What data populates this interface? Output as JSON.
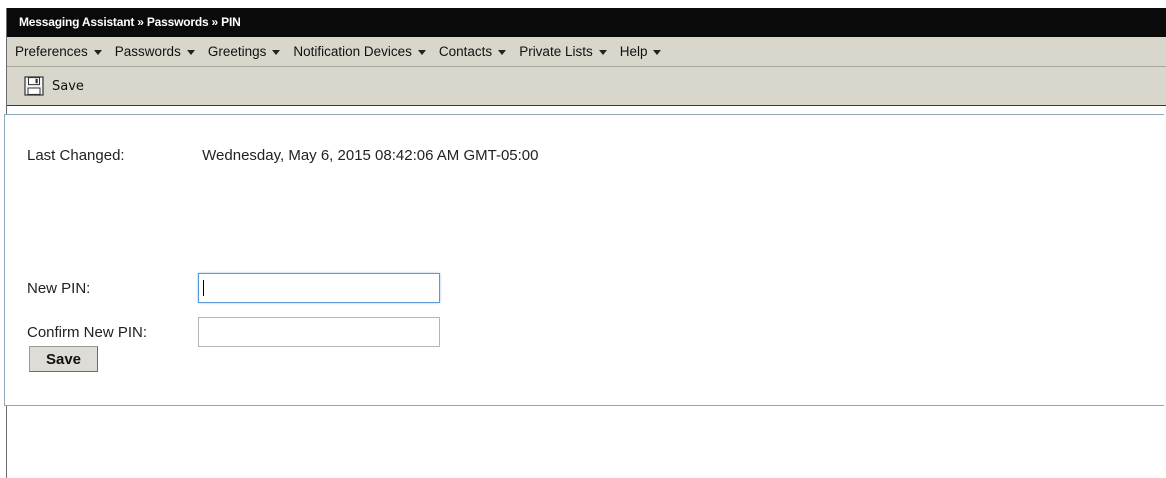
{
  "header": {
    "breadcrumb": "Messaging Assistant » Passwords » PIN"
  },
  "menu": [
    {
      "label": "Preferences"
    },
    {
      "label": "Passwords"
    },
    {
      "label": "Greetings"
    },
    {
      "label": "Notification Devices"
    },
    {
      "label": "Contacts"
    },
    {
      "label": "Private Lists"
    },
    {
      "label": "Help"
    }
  ],
  "toolbar": {
    "save_label": "Save",
    "save_icon": "floppy-disk-icon"
  },
  "form": {
    "last_changed_label": "Last Changed:",
    "last_changed_value": "Wednesday, May 6, 2015 08:42:06 AM GMT-05:00",
    "new_pin_label": "New PIN:",
    "new_pin_value": "",
    "confirm_pin_label": "Confirm New PIN:",
    "confirm_pin_value": "",
    "save_button_label": "Save"
  }
}
